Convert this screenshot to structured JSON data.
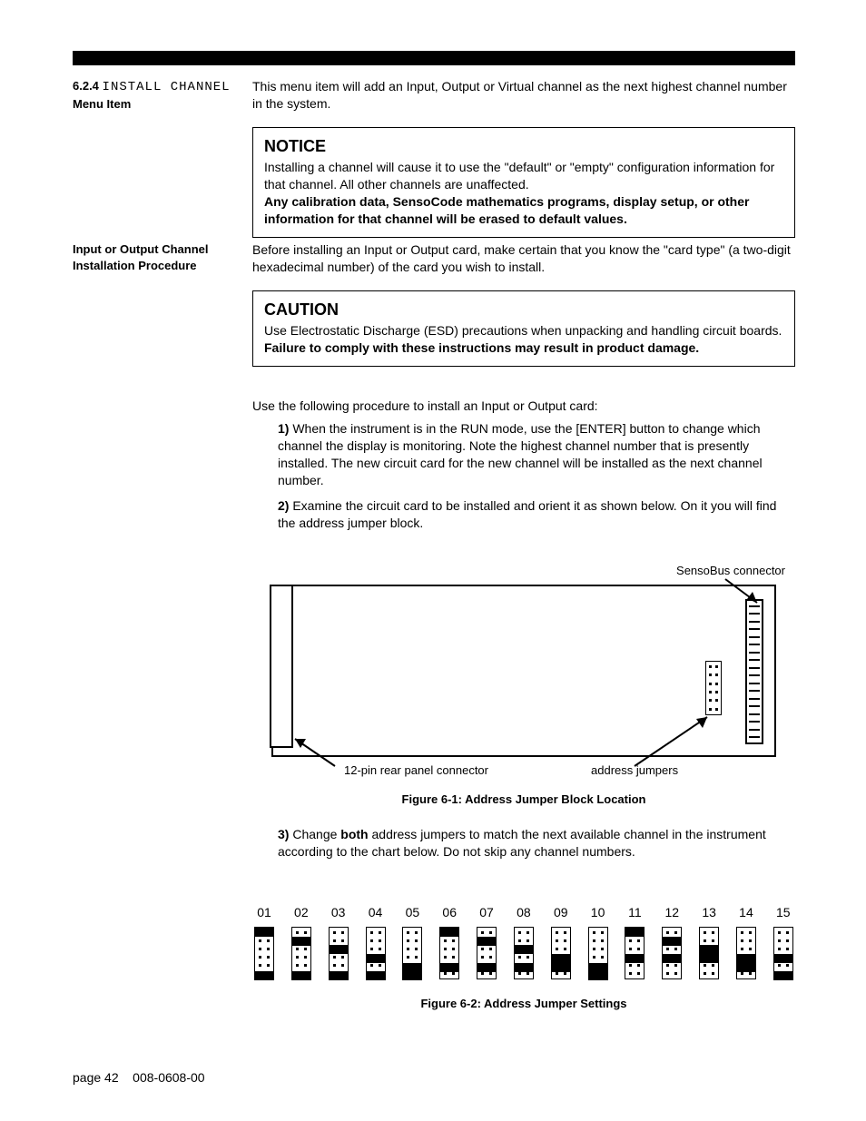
{
  "sidebar": {
    "section_num": "6.2.4",
    "section_menu": "INSTALL CHANNEL",
    "section_sub": "Menu Item",
    "proc_heading_l1": "Input or Output Channel",
    "proc_heading_l2": "Installation Procedure"
  },
  "intro": "This menu item will add an Input, Output or Virtual channel as the next highest channel number in the system.",
  "notice": {
    "title": "NOTICE",
    "p1": "Installing a channel will cause it to use the \"default\" or \"empty\" configuration information for that channel.  All other channels are unaffected.",
    "p2_bold": "Any calibration data, SensoCode mathematics programs, display setup, or other information for that channel will be erased to default values."
  },
  "pre_caution": "Before installing an Input or Output card, make certain that you know the \"card type\" (a two-digit hexadecimal number) of the card you wish to install.",
  "caution": {
    "title": "CAUTION",
    "p1": "Use Electrostatic Discharge (ESD) precautions when unpacking and handling circuit boards.",
    "p2_bold": "Failure to comply with these instructions may result in product damage."
  },
  "procedure_intro": "Use the following procedure to install an Input or Output card:",
  "steps": {
    "s1_num": "1)",
    "s1": "When the instrument is in the RUN mode, use the [ENTER] button to change which channel the display is monitoring.  Note the highest channel number that is presently installed. The new circuit card for the new channel will be installed as the next channel number.",
    "s2_num": "2)",
    "s2": "Examine the circuit card to be installed and orient it as shown below.  On it you will find the address jumper block.",
    "s3_num": "3)",
    "s3a": "Change ",
    "s3_bold": "both",
    "s3b": " address jumpers to match the next available channel in the instrument according to the chart below.  Do not skip any channel numbers."
  },
  "fig1": {
    "label_senso": "SensoBus connector",
    "label_rear": "12-pin rear panel connector",
    "label_addr": "address jumpers",
    "caption": "Figure 6-1: Address Jumper Block Location"
  },
  "fig2": {
    "caption": "Figure 6-2: Address Jumper Settings",
    "cols": [
      "01",
      "02",
      "03",
      "04",
      "05",
      "06",
      "07",
      "08",
      "09",
      "10",
      "11",
      "12",
      "13",
      "14",
      "15"
    ]
  },
  "footer": {
    "page": "page 42",
    "docnum": "008-0608-00"
  },
  "chart_data": {
    "type": "table",
    "title": "Figure 6-2: Address Jumper Settings",
    "note": "Each channel has two jumper positions (rows 0-5 on a 2x6 pin block). Values list the row index (0=top) where each of the two black jumpers sits.",
    "columns": [
      "channel",
      "jumper_a_row",
      "jumper_b_row"
    ],
    "rows": [
      [
        "01",
        0,
        5
      ],
      [
        "02",
        1,
        5
      ],
      [
        "03",
        2,
        5
      ],
      [
        "04",
        3,
        5
      ],
      [
        "05",
        4,
        5
      ],
      [
        "06",
        0,
        4
      ],
      [
        "07",
        1,
        4
      ],
      [
        "08",
        2,
        4
      ],
      [
        "09",
        3,
        4
      ],
      [
        "10",
        5,
        4
      ],
      [
        "11",
        0,
        3
      ],
      [
        "12",
        1,
        3
      ],
      [
        "13",
        2,
        3
      ],
      [
        "14",
        4,
        3
      ],
      [
        "15",
        5,
        3
      ]
    ]
  }
}
